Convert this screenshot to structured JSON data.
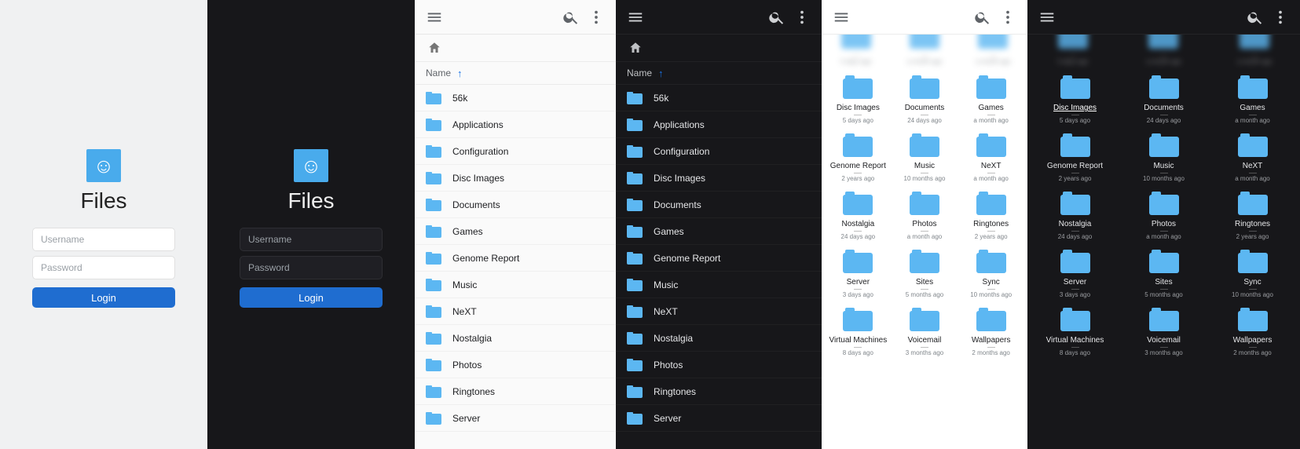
{
  "app": {
    "title": "Files"
  },
  "login": {
    "username_placeholder": "Username",
    "password_placeholder": "Password",
    "button_label": "Login"
  },
  "list": {
    "column_label": "Name",
    "items": [
      "56k",
      "Applications",
      "Configuration",
      "Disc Images",
      "Documents",
      "Games",
      "Genome Report",
      "Music",
      "NeXT",
      "Nostalgia",
      "Photos",
      "Ringtones",
      "Server"
    ]
  },
  "grid": {
    "items": [
      {
        "name": "Disc Images",
        "meta": "5 days ago"
      },
      {
        "name": "Documents",
        "meta": "24 days ago"
      },
      {
        "name": "Games",
        "meta": "a month ago"
      },
      {
        "name": "Genome Report",
        "meta": "2 years ago"
      },
      {
        "name": "Music",
        "meta": "10 months ago"
      },
      {
        "name": "NeXT",
        "meta": "a month ago"
      },
      {
        "name": "Nostalgia",
        "meta": "24 days ago"
      },
      {
        "name": "Photos",
        "meta": "a month ago"
      },
      {
        "name": "Ringtones",
        "meta": "2 years ago"
      },
      {
        "name": "Server",
        "meta": "3 days ago"
      },
      {
        "name": "Sites",
        "meta": "5 months ago"
      },
      {
        "name": "Sync",
        "meta": "10 months ago"
      },
      {
        "name": "Virtual Machines",
        "meta": "8 days ago"
      },
      {
        "name": "Voicemail",
        "meta": "3 months ago"
      },
      {
        "name": "Wallpapers",
        "meta": "2 months ago"
      }
    ],
    "peek": [
      {
        "meta": "5 days ago"
      },
      {
        "meta": "a month ago"
      },
      {
        "meta": "a month ago"
      }
    ]
  },
  "colors": {
    "accent": "#1f6dd0",
    "folder": "#5cb7f2"
  }
}
